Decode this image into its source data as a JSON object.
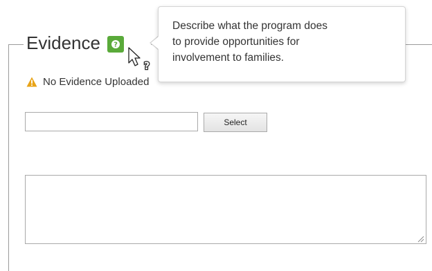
{
  "section": {
    "title": "Evidence",
    "help_icon": "question-icon"
  },
  "status": {
    "icon": "warning-icon",
    "text": "No Evidence Uploaded",
    "icon_color": "#e8a317"
  },
  "upload": {
    "file_value": "",
    "select_label": "Select"
  },
  "notes": {
    "value": ""
  },
  "tooltip": {
    "lines": [
      "Describe what the program does",
      "to provide opportunities for",
      "involvement to families."
    ]
  },
  "colors": {
    "help_green": "#5aaa3a",
    "border": "#a9a9a9",
    "text": "#333333"
  }
}
